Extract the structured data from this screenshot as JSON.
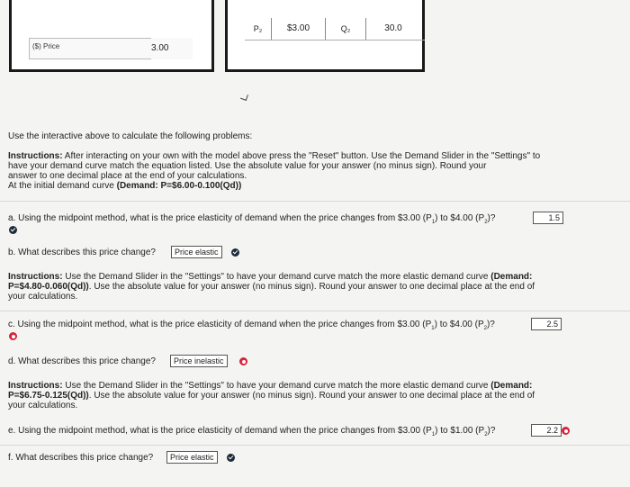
{
  "widget": {
    "price_label": "($) Price",
    "price_value": "3.00",
    "p2_label": "P₂",
    "p2_value": "$3.00",
    "q2_label": "Q₂",
    "q2_value": "30.0"
  },
  "intro": "Use the interactive above to calculate the following problems:",
  "instructions1": {
    "label": "Instructions:",
    "line1": " After interacting on your own with the model above press the \"Reset\" button. Use the Demand Slider in the \"Settings\" to",
    "line2": "have your demand curve match the equation listed.  Use the absolute value for your answer (no minus sign).  Round your",
    "line3": "answer to one decimal place at the end of your calculations.",
    "line4_prefix": "At the initial demand curve ",
    "line4_bold": "(Demand: P=$6.00-0.100(Qd))"
  },
  "question_a": {
    "text": "a. Using the midpoint method, what is the price elasticity of demand when the price changes from $3.00 (P",
    "sub1": "1",
    "mid": ") to $4.00 (P",
    "sub2": "2",
    "end": ")?",
    "answer": "1.5"
  },
  "question_b": {
    "text": "b. What describes this price change?",
    "answer": "Price elastic"
  },
  "instructions2": {
    "label": "Instructions:",
    "line1": " Use the Demand Slider in the \"Settings\" to have your demand curve match the more elastic demand curve ",
    "line1_bold": "(Demand:",
    "line2_bold": "P=$4.80-0.060(Qd))",
    "line2": ". Use the absolute value for your answer (no minus sign).  Round your answer to one decimal place at the end of",
    "line3": "your calculations."
  },
  "question_c": {
    "text": "c. Using the midpoint method, what is the price elasticity of demand when the price changes from $3.00 (P",
    "sub1": "1",
    "mid": ") to $4.00 (P",
    "sub2": "2",
    "end": ")?",
    "answer": "2.5"
  },
  "question_d": {
    "text": "d. What describes this price change?",
    "answer": "Price inelastic"
  },
  "instructions3": {
    "label": "Instructions:",
    "line1": " Use the Demand Slider in the \"Settings\" to have your demand curve match the more elastic demand curve ",
    "line1_bold": "(Demand:",
    "line2_bold": "P=$6.75-0.125(Qd))",
    "line2": ". Use the absolute value for your answer (no minus sign).  Round your answer to one decimal place at the end of",
    "line3": "your calculations."
  },
  "question_e": {
    "text": "e. Using the midpoint method, what is the price elasticity of demand when the price changes from $3.00 (P",
    "sub1": "1",
    "mid": ") to $1.00 (P",
    "sub2": "2",
    "end": ")?",
    "answer": "2.2"
  },
  "question_f": {
    "text": "f. What describes this price change?",
    "answer": "Price elastic"
  }
}
